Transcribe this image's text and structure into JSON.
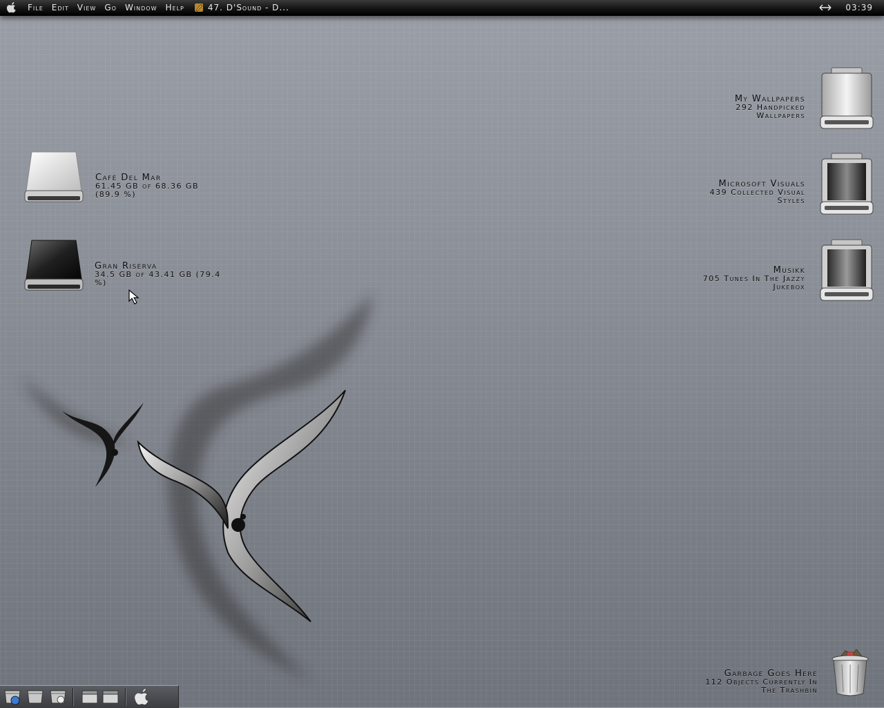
{
  "menubar": {
    "apple_icon": "apple-logo-icon",
    "menus": [
      "File",
      "Edit",
      "View",
      "Go",
      "Window",
      "Help"
    ],
    "now_playing": "47. D'Sound - D...",
    "now_playing_icon": "pencil-note-icon",
    "network_icon": "double-arrow-icon",
    "clock": "03:39"
  },
  "desktop": {
    "left_drives": [
      {
        "name": "Cafè Del Mar",
        "detail_1": "61.45 GB of 68.36 GB",
        "detail_2": "(89.9 %)",
        "icon": "white-hard-drive-icon"
      },
      {
        "name": "Gran Riserva",
        "detail_1": "34.5 GB of 43.41 GB (79.4",
        "detail_2": "%)",
        "icon": "black-hard-drive-icon"
      }
    ],
    "right_drives": [
      {
        "name": "My Wallpapers",
        "detail_1": "292 Handpicked",
        "detail_2": "Wallpapers",
        "icon": "silver-drive-icon"
      },
      {
        "name": "Microsoft Visuals",
        "detail_1": "439  Collected Visual",
        "detail_2": "Styles",
        "icon": "dark-drive-icon"
      },
      {
        "name": "Musikk",
        "detail_1": "705 Tunes In The Jazzy",
        "detail_2": "Jukebox",
        "icon": "dark-drive-icon"
      }
    ],
    "trash": {
      "name": "Garbage Goes Here",
      "detail_1": "112 Objects Currently In",
      "detail_2": "The Trashbin",
      "icon": "trash-can-icon"
    }
  },
  "dock": {
    "items": [
      "finder-icon",
      "folder-icon",
      "apple-folder-icon",
      "drawer-icon",
      "drawer-icon",
      "apple-logo-icon"
    ]
  },
  "colors": {
    "menubar": "#111111",
    "desktop": "#8c9098",
    "text": "#0d0d0d"
  }
}
